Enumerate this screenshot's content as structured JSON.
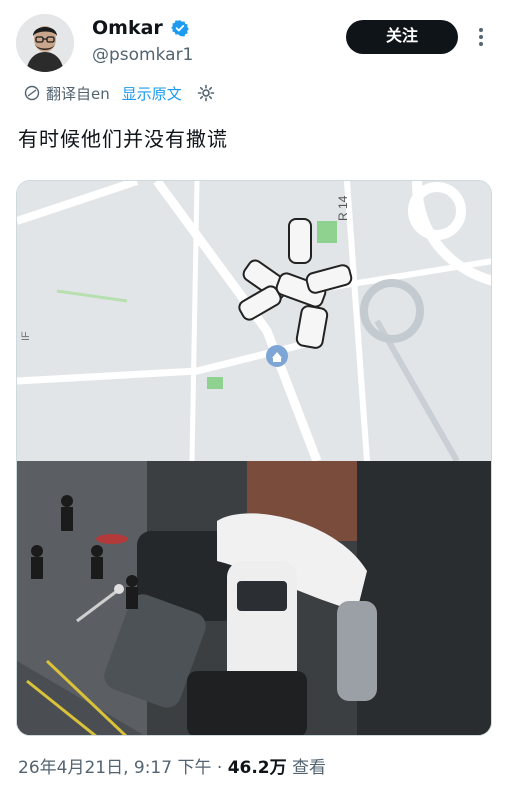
{
  "author": {
    "display_name": "Omkar",
    "handle": "@psomkar1"
  },
  "follow_label": "关注",
  "translation": {
    "label": "翻译自en",
    "show_original": "显示原文"
  },
  "post_text": "有时候他们并没有撒谎",
  "media": {
    "map_labels": [
      "R 14",
      "IF"
    ]
  },
  "meta": {
    "timestamp": "26年4月21日, 9:17 下午",
    "separator": "·",
    "views": "46.2万",
    "views_suffix": "查看"
  },
  "colors": {
    "accent": "#1d9bf0",
    "text": "#0f1419",
    "secondary": "#536471",
    "follow_bg": "#0f1419"
  }
}
